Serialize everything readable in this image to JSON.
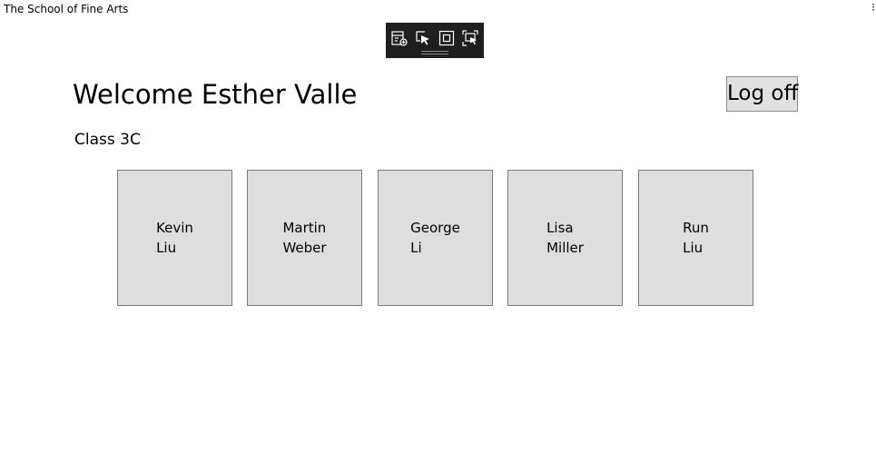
{
  "window": {
    "title": "The School of Fine Arts",
    "menu_glyph": "⁝"
  },
  "dev_toolbar": {
    "tools": [
      {
        "icon": "live-visual-tree-icon"
      },
      {
        "icon": "select-element-icon"
      },
      {
        "icon": "display-layout-adorners-icon"
      },
      {
        "icon": "track-focus-icon"
      }
    ]
  },
  "header": {
    "welcome": "Welcome Esther Valle",
    "logoff_label": "Log off"
  },
  "class_label": "Class 3C",
  "students": [
    {
      "first": "Kevin",
      "last": "Liu"
    },
    {
      "first": "Martin",
      "last": "Weber"
    },
    {
      "first": "George",
      "last": "Li"
    },
    {
      "first": "Lisa",
      "last": "Miller"
    },
    {
      "first": "Run",
      "last": "Liu"
    }
  ],
  "colors": {
    "card_background": "#dedede",
    "button_background": "#e1e1e1",
    "toolbar_background": "#1f1f1f"
  }
}
